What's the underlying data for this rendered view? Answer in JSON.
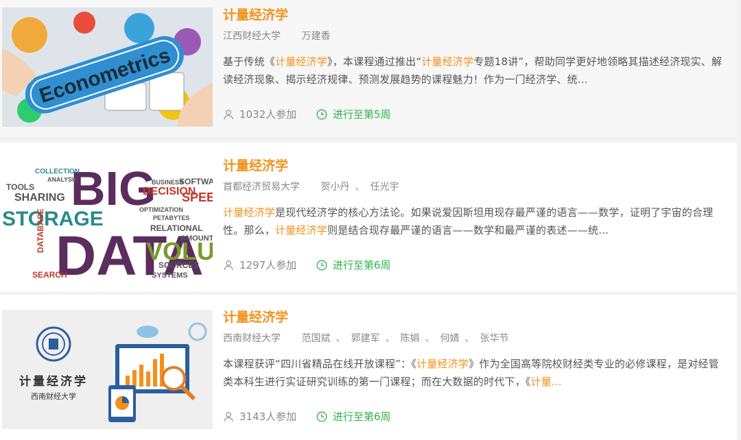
{
  "courses": [
    {
      "title": "计量经济学",
      "school": "江西财经大学",
      "teachers": [
        "万建香"
      ],
      "description": [
        {
          "t": "基于传统《"
        },
        {
          "t": "计量经济学",
          "hl": true
        },
        {
          "t": "》，本课程通过推出“"
        },
        {
          "t": "计量经济学",
          "hl": true
        },
        {
          "t": "专题18讲”，帮助同学更好地领略其描述经济现实、解读经济现象、揭示经济规律、预测发展趋势的课程魅力！作为一门经济学、统..."
        }
      ],
      "participants": "1032人参加",
      "progress": "进行至第5周",
      "thumbnail": {
        "text": "Econometrics"
      }
    },
    {
      "title": "计量经济学",
      "school": "首都经济贸易大学",
      "teachers": [
        "贺小丹",
        "任光宇"
      ],
      "description": [
        {
          "t": "计量经济学",
          "hl": true
        },
        {
          "t": "是现代经济学的核心方法论。如果说爱因斯坦用现存最严谨的语言——数学，证明了宇宙的合理性。那么，"
        },
        {
          "t": "计量经济学",
          "hl": true
        },
        {
          "t": "则是结合现存最严谨的语言——数学和最严谨的表述——统..."
        }
      ],
      "participants": "1297人参加",
      "progress": "进行至第6周",
      "thumbnail": {
        "words": [
          "BIG",
          "DATA",
          "STORAGE",
          "VOLUME",
          "DECISION",
          "SPEED",
          "SOFTWARE",
          "BUSINESS",
          "RELATIONAL",
          "PETABYTES",
          "SHARING",
          "TOOLS",
          "SOURCES",
          "SYSTEMS",
          "COLLECTION",
          "ANALYSIS",
          "DATABASE",
          "SEARCH",
          "AMOUNT",
          "OPTIMIZATION"
        ]
      }
    },
    {
      "title": "计量经济学",
      "school": "西南财经大学",
      "teachers": [
        "范国斌",
        "郭建军",
        "陈娟",
        "何婧",
        "张华节"
      ],
      "description": [
        {
          "t": "本课程获评“四川省精品在线开放课程”：《"
        },
        {
          "t": "计量经济学",
          "hl": true
        },
        {
          "t": "》作为全国高等院校财经类专业的必修课程，是对经管类本科生进行实证研究训练的第一门课程；而在大数据的时代下，《"
        },
        {
          "t": "计量...",
          "hl": true
        }
      ],
      "participants": "3143人参加",
      "progress": "进行至第6周",
      "thumbnail": {
        "title": "计量经济学",
        "subtitle": "西南财经大学"
      }
    }
  ],
  "colors": {
    "accent": "#f39019",
    "progress": "#2cb34a",
    "meta": "#888888"
  },
  "icons": {
    "participants": "person-icon",
    "progress": "clock-icon"
  }
}
